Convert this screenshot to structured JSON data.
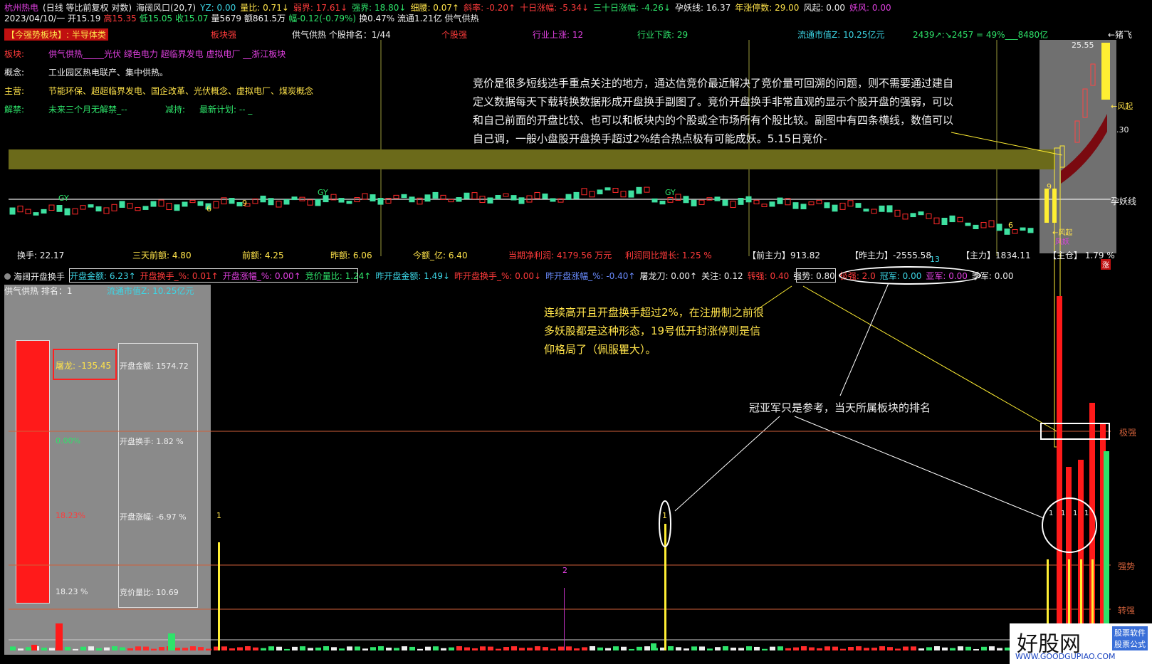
{
  "header": {
    "line1": [
      {
        "text": "杭州热电",
        "color": "#e040e0"
      },
      {
        "text": "(日线 等比前复权 对数)",
        "color": "#f0f0f0"
      },
      {
        "text": "海阔风口(20,7)",
        "color": "#f0f0f0"
      },
      {
        "text": "YZ: 0.00",
        "color": "#3cd6e6"
      },
      {
        "text": "量比: 0.71↓",
        "color": "#ffe34a"
      },
      {
        "text": "弱界: 17.61↓",
        "color": "#ff3b3b"
      },
      {
        "text": "强界: 18.80↓",
        "color": "#2ee36a"
      },
      {
        "text": "细腰: 0.07↑",
        "color": "#ffe34a"
      },
      {
        "text": "斜率: -0.20↑",
        "color": "#ff3b3b"
      },
      {
        "text": "十日涨幅: -5.34↓",
        "color": "#ff3b3b"
      },
      {
        "text": "三十日涨幅: -4.26↓",
        "color": "#2ee36a"
      },
      {
        "text": "孕妖线: 16.37",
        "color": "#f0f0f0"
      },
      {
        "text": "年涨停数: 29.00",
        "color": "#ffe34a"
      },
      {
        "text": "风起: 0.00",
        "color": "#f0f0f0"
      },
      {
        "text": "妖风: 0.00",
        "color": "#e040e0"
      }
    ],
    "line2": [
      {
        "text": "2023/04/10/一 开15.19",
        "color": "#f0f0f0"
      },
      {
        "text": "高15.35",
        "color": "#ff3b3b"
      },
      {
        "text": "低15.05",
        "color": "#2ee36a"
      },
      {
        "text": "收15.07",
        "color": "#2ee36a"
      },
      {
        "text": "量5679 额861.5万",
        "color": "#f0f0f0"
      },
      {
        "text": "幅-0.12(-0.79%)",
        "color": "#2ee36a"
      },
      {
        "text": "换0.47% 流通1.21亿 供气供热",
        "color": "#f0f0f0"
      }
    ]
  },
  "info_rows": {
    "strong_sector_tag": "【今强势板块】: 半导体类",
    "sector_strong_tag": "板块强",
    "rank_label": "供气供热 个股排名：1/44",
    "stock_strong_tag": "个股强",
    "industry_up": "行业上涨: 12",
    "industry_down": "行业下跌: 29",
    "float_value": "流通市值Z: 10.25亿元",
    "market_breadth": "2439↗:↘2457 = 49%___8480亿",
    "sector_label": "板块:",
    "sector_value": "供气供热_____光伏 绿色电力 超临界发电 虚拟电厂 __浙江板块",
    "concept_label": "概念:",
    "concept_value": "工业园区热电联产、集中供热。",
    "main_label": "主营:",
    "main_value": "节能环保、超超临界发电、国企改革、光伏概念、虚拟电厂、煤炭概念",
    "unlock_label": "解禁:",
    "unlock_value": "未来三个月无解禁_--",
    "reduce_label": "减持:",
    "reduce_value": "最新计划: -- _"
  },
  "right_labels": {
    "pig_fly": "←猪飞",
    "price_top": "25.55",
    "wind": "←风起",
    "price_mid": ".30",
    "pregnant_line": "孕妖线",
    "wind_small": "←风起",
    "wind_small2": "风妖",
    "zhang": "涨"
  },
  "kline_marks": {
    "gy1": "GY",
    "gy2": "GY",
    "gy3": "GY",
    "n6a": "6",
    "n9a": "9",
    "n9b": "9",
    "n6b": "6",
    "n13": "13"
  },
  "bottom_stats": [
    {
      "text": "换手: 22.17",
      "color": "#f0f0f0"
    },
    {
      "text": "三天前额: 4.80",
      "color": "#ffe34a"
    },
    {
      "text": "前额: 4.25",
      "color": "#ffe34a"
    },
    {
      "text": "昨额: 6.06",
      "color": "#ffe34a"
    },
    {
      "text": "今额_亿: 6.40",
      "color": "#ffe34a"
    },
    {
      "text": "当期净利润: 4179.56 万元",
      "color": "#ff3b3b"
    },
    {
      "text": "利润同比增长: 1.25 %",
      "color": "#ff3b3b"
    },
    {
      "text": "【前主力】913.82",
      "color": "#f0f0f0"
    },
    {
      "text": "【昨主力】-2555.58",
      "color": "#f0f0f0"
    },
    {
      "text": "【主力】1834.11",
      "color": "#f0f0f0"
    },
    {
      "text": "【主仓】 1.79 %",
      "color": "#f0f0f0"
    }
  ],
  "sub_header": {
    "title": "海阔开盘换手",
    "items": [
      {
        "text": "开盘金额: 6.23↑",
        "color": "#3cd6e6"
      },
      {
        "text": "开盘换手_%: 0.01↑",
        "color": "#ff3b3b"
      },
      {
        "text": "开盘涨幅_%: 0.00↑",
        "color": "#e040e0"
      },
      {
        "text": "竞价量比: 1.24↑",
        "color": "#2ee36a"
      },
      {
        "text": "昨开盘金额: 1.49↓",
        "color": "#3cd6e6"
      },
      {
        "text": "昨开盘换手_%: 0.00↓",
        "color": "#ff3b3b"
      },
      {
        "text": "昨开盘涨幅_%: -0.40↑",
        "color": "#6a8cff"
      },
      {
        "text": "屠龙刀: 0.00↑",
        "color": "#f0f0f0"
      },
      {
        "text": "关注: 0.12",
        "color": "#f0f0f0"
      },
      {
        "text": "转强: 0.40",
        "color": "#ff3b3b"
      },
      {
        "text": "强势: 0.80",
        "color": "#f0f0f0"
      },
      {
        "text": "极强: 2.0",
        "color": "#ff3b3b"
      },
      {
        "text": "冠军: 0.00",
        "color": "#3cd6e6"
      },
      {
        "text": "亚军: 0.00",
        "color": "#e040e0"
      },
      {
        "text": "季军: 0.00",
        "color": "#f0f0f0"
      }
    ],
    "row2_left": "供气供热   排名：1",
    "row2_right": "流通市值Z: 10.25亿元"
  },
  "left_panel": {
    "tulong": "屠龙: -135.45",
    "pct_green": "0.00%",
    "pct_red": "18.23%",
    "pct_white": "18.23 %",
    "open_amount": "开盘金额: 1574.72",
    "open_turnover": "开盘换手: 1.82 %",
    "open_change": "开盘涨幅: -6.97 %",
    "auction_ratio": "竞价量比: 10.69"
  },
  "annotations": {
    "para1": "竞价是很多短线选手重点关注的地方，通达信竞价最近解决了竞价量可回溯的问题，则不需要通过建自定义数据每天下载转换数据形成开盘换手副图了。竞价开盘换手非常直观的显示个股开盘的强弱，可以和自己前面的开盘比较、也可以和板块内的个股或全市场所有个股比较。副图中有四条横线，数值可以自己调，一般小盘股开盘换手超过2%结合热点极有可能成妖。5.15日竞价-",
    "para2": "连续高开且开盘换手超过2%，在注册制之前很多妖股都是这种形态，19号低开封涨停则是信仰格局了（佩服瞿大）。",
    "para3": "冠亚军只是参考，当天所属板块的排名"
  },
  "sub_right_labels": {
    "extreme": "极强",
    "strong": "强势",
    "turn": "转强"
  },
  "sub_marks": {
    "one_a": "1",
    "two": "2",
    "one_b": "1",
    "r1": "1",
    "r2": "1",
    "r3": "1",
    "r4": "1"
  },
  "logo": {
    "name": "好股网",
    "tag1": "股票软件",
    "tag2": "股票公式",
    "url": "WWW.GOODGUPIAO.COM"
  },
  "colors": {
    "up": "#ff2a2a",
    "down": "#3ee0a0",
    "band": "#6b6a1a",
    "yellow": "#ffee33"
  }
}
